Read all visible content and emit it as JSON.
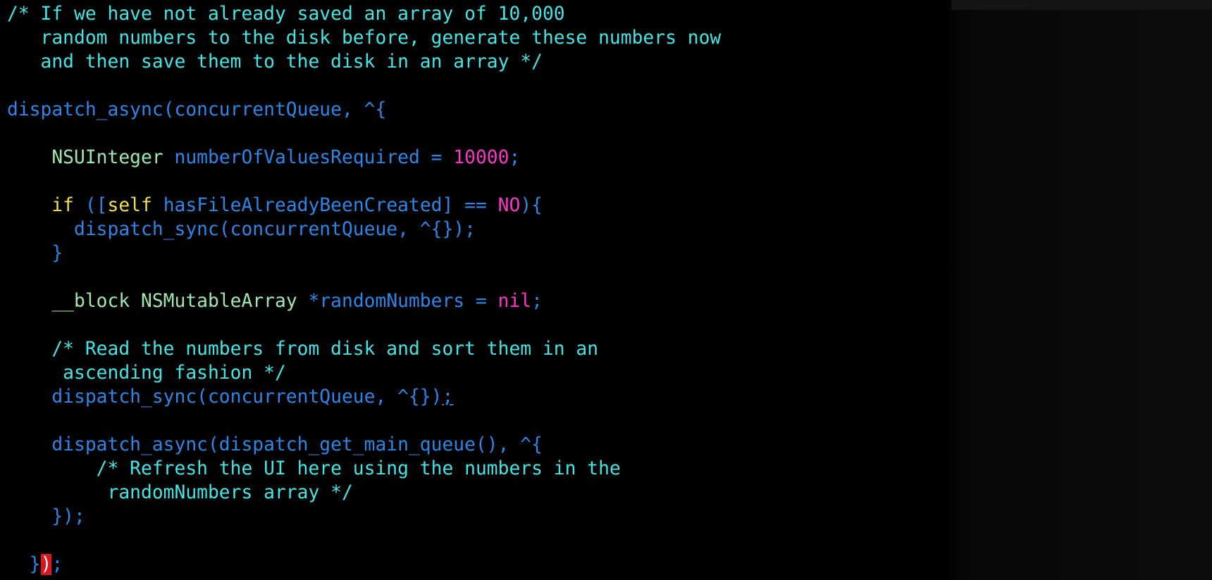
{
  "editor": {
    "lines": [
      [
        {
          "t": "/* If we have not already saved an array of 10,000",
          "c": "comment"
        }
      ],
      [
        {
          "t": "   random numbers to the disk before, generate these numbers now",
          "c": "comment"
        }
      ],
      [
        {
          "t": "   and then save them to the disk in an array */",
          "c": "comment"
        }
      ],
      [],
      [
        {
          "t": "dispatch_async(concurrentQueue, ^{",
          "c": "plain"
        }
      ],
      [],
      [
        {
          "t": "    ",
          "c": "plain"
        },
        {
          "t": "NSUInteger",
          "c": "type"
        },
        {
          "t": " numberOfValuesRequired = ",
          "c": "plain"
        },
        {
          "t": "10000",
          "c": "number"
        },
        {
          "t": ";",
          "c": "plain"
        }
      ],
      [],
      [
        {
          "t": "    ",
          "c": "plain"
        },
        {
          "t": "if",
          "c": "keyword"
        },
        {
          "t": " ([",
          "c": "plain"
        },
        {
          "t": "self",
          "c": "keyword"
        },
        {
          "t": " hasFileAlreadyBeenCreated] == ",
          "c": "plain"
        },
        {
          "t": "NO",
          "c": "const"
        },
        {
          "t": "){",
          "c": "plain"
        }
      ],
      [
        {
          "t": "      dispatch_sync(concurrentQueue, ^{});",
          "c": "plain"
        }
      ],
      [
        {
          "t": "    }",
          "c": "plain"
        }
      ],
      [],
      [
        {
          "t": "    ",
          "c": "plain"
        },
        {
          "t": "__block NSMutableArray",
          "c": "type"
        },
        {
          "t": " *randomNumbers = ",
          "c": "plain"
        },
        {
          "t": "nil",
          "c": "const"
        },
        {
          "t": ";",
          "c": "plain"
        }
      ],
      [],
      [
        {
          "t": "    /* Read the numbers from disk and sort them in an",
          "c": "comment"
        }
      ],
      [
        {
          "t": "     ascending fashion */",
          "c": "comment"
        }
      ],
      [
        {
          "t": "    dispatch_sync(concurrentQueue, ^{})",
          "c": "plain"
        },
        {
          "t": ";",
          "c": "under"
        }
      ],
      [],
      [
        {
          "t": "    dispatch_async(dispatch_get_main_queue(), ^{",
          "c": "plain"
        }
      ],
      [
        {
          "t": "        /* Refresh the UI here using the numbers in the",
          "c": "comment"
        }
      ],
      [
        {
          "t": "         randomNumbers array */",
          "c": "comment"
        }
      ],
      [
        {
          "t": "    });",
          "c": "plain"
        }
      ],
      [],
      [
        {
          "t": "  }",
          "c": "plain"
        },
        {
          "t": ")",
          "c": "cursor"
        },
        {
          "t": ";",
          "c": "plain"
        }
      ]
    ]
  },
  "colors": {
    "background": "#000000",
    "comment": "#3fe6e6",
    "plain": "#2a86e8",
    "type": "#9ee8b0",
    "keyword": "#f0e04a",
    "number": "#ff33cc",
    "cursor": "#e0141e"
  }
}
